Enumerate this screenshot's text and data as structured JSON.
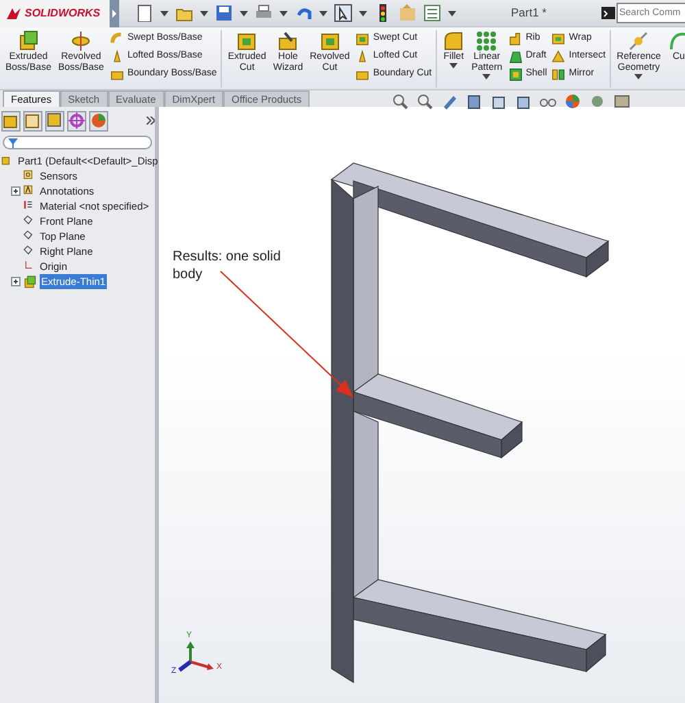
{
  "app": {
    "logo": "SOLIDWORKS",
    "title": "Part1 *",
    "search": {
      "placeholder": "Search Comm"
    }
  },
  "ribbon": [
    [
      {
        "kind": "large",
        "lines": [
          "Extruded",
          "Boss/Base"
        ],
        "menu": false
      },
      {
        "kind": "large",
        "lines": [
          "Revolved",
          "Boss/Base"
        ],
        "menu": false
      },
      {
        "kind": "stack",
        "items": [
          "Swept Boss/Base",
          "Lofted Boss/Base",
          "Boundary Boss/Base"
        ]
      }
    ],
    [
      {
        "kind": "large",
        "lines": [
          "Extruded",
          "Cut"
        ],
        "menu": false
      },
      {
        "kind": "large",
        "lines": [
          "Hole",
          "Wizard"
        ],
        "menu": false
      },
      {
        "kind": "large",
        "lines": [
          "Revolved",
          "Cut"
        ],
        "menu": false
      },
      {
        "kind": "stack",
        "items": [
          "Swept Cut",
          "Lofted Cut",
          "Boundary Cut"
        ]
      }
    ],
    [
      {
        "kind": "large",
        "lines": [
          "Fillet"
        ],
        "menu": true
      },
      {
        "kind": "large",
        "lines": [
          "Linear",
          "Pattern"
        ],
        "menu": true
      },
      {
        "kind": "stack",
        "items": [
          "Rib",
          "Draft",
          "Shell"
        ]
      },
      {
        "kind": "stack",
        "items": [
          "Wrap",
          "Intersect",
          "Mirror"
        ]
      }
    ],
    [
      {
        "kind": "large",
        "lines": [
          "Reference",
          "Geometry"
        ],
        "menu": true
      },
      {
        "kind": "large",
        "lines": [
          "Cu"
        ],
        "menu": false
      }
    ]
  ],
  "tabs": [
    {
      "label": "Features",
      "selected": true
    },
    {
      "label": "Sketch",
      "selected": false
    },
    {
      "label": "Evaluate",
      "selected": false
    },
    {
      "label": "DimXpert",
      "selected": false
    },
    {
      "label": "Office Products",
      "selected": false
    }
  ],
  "tree": [
    {
      "label": "Part1  (Default<<Default>_Disp",
      "kind": "part",
      "expandable": false,
      "selected": false,
      "children": [
        {
          "label": "Sensors",
          "kind": "sensors",
          "expandable": false,
          "selected": false
        },
        {
          "label": "Annotations",
          "kind": "annotations",
          "expandable": true,
          "selected": false
        },
        {
          "label": "Material <not specified>",
          "kind": "material",
          "expandable": false,
          "selected": false
        },
        {
          "label": "Front Plane",
          "kind": "plane",
          "expandable": false,
          "selected": false
        },
        {
          "label": "Top Plane",
          "kind": "plane",
          "expandable": false,
          "selected": false
        },
        {
          "label": "Right Plane",
          "kind": "plane",
          "expandable": false,
          "selected": false
        },
        {
          "label": "Origin",
          "kind": "origin",
          "expandable": false,
          "selected": false
        },
        {
          "label": "Extrude-Thin1",
          "kind": "feature",
          "expandable": true,
          "selected": true
        }
      ]
    }
  ],
  "annotation": {
    "text": "Results: one solid body"
  },
  "triad": {
    "x": "X",
    "y": "Y",
    "z": "Z"
  }
}
